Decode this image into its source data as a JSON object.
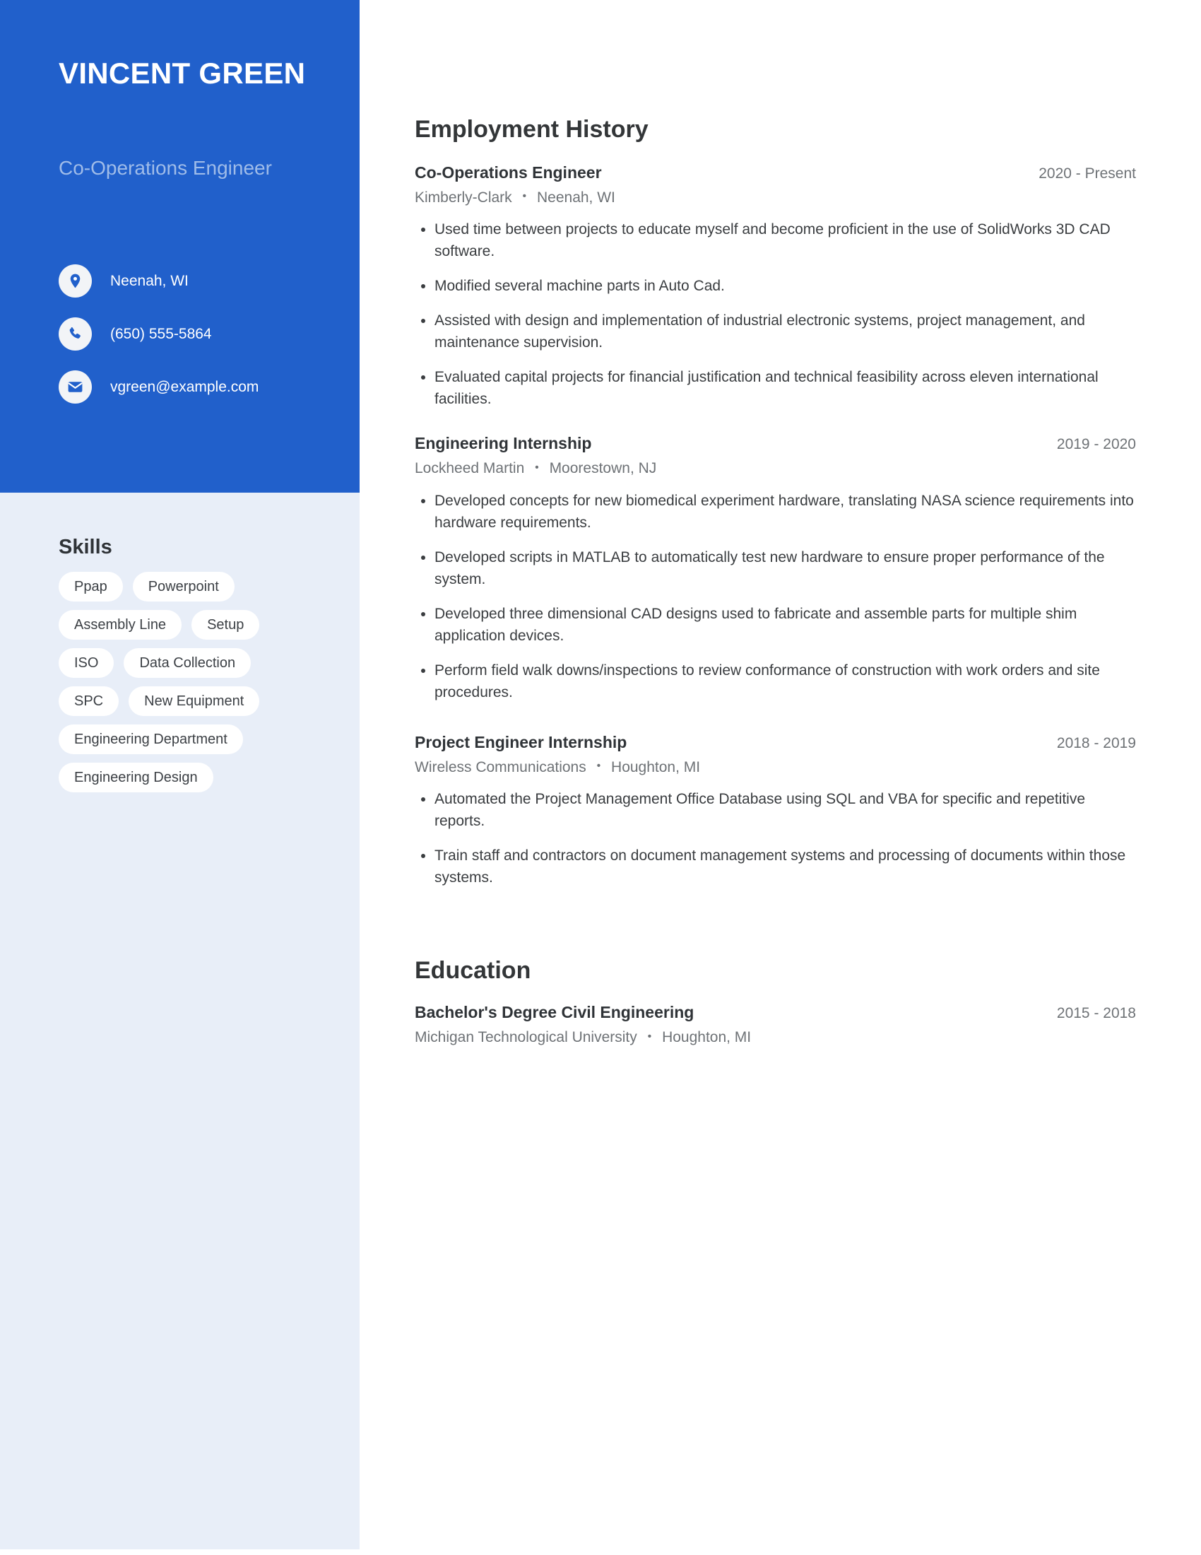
{
  "colors": {
    "accent": "#2160cb",
    "sidebar_bg": "#e8eef8",
    "subtitle": "#9fbce9",
    "heading": "#333638",
    "muted": "#6e7276"
  },
  "sidebar": {
    "name": "VINCENT GREEN",
    "job_title": "Co-Operations Engineer",
    "contacts": [
      {
        "icon": "location-pin-icon",
        "value": "Neenah, WI"
      },
      {
        "icon": "phone-icon",
        "value": "(650) 555-5864"
      },
      {
        "icon": "envelope-icon",
        "value": "vgreen@example.com"
      }
    ],
    "skills_heading": "Skills",
    "skills": [
      "Ppap",
      "Powerpoint",
      "Assembly Line",
      "Setup",
      "ISO",
      "Data Collection",
      "SPC",
      "New Equipment",
      "Engineering Department",
      "Engineering Design"
    ]
  },
  "main": {
    "employment": {
      "heading": "Employment History",
      "entries": [
        {
          "title": "Co-Operations Engineer",
          "date": "2020 - Present",
          "company": "Kimberly-Clark",
          "location": "Neenah, WI",
          "bullets": [
            "Used time between projects to educate myself and become proficient in the use of SolidWorks 3D CAD software.",
            "Modified several machine parts in Auto Cad.",
            "Assisted with design and implementation of industrial electronic systems, project management, and maintenance supervision.",
            "Evaluated capital projects for financial justification and technical feasibility across eleven international facilities."
          ]
        },
        {
          "title": "Engineering Internship",
          "date": "2019 - 2020",
          "company": "Lockheed Martin",
          "location": "Moorestown, NJ",
          "bullets": [
            "Developed concepts for new biomedical experiment hardware, translating NASA science requirements into hardware requirements.",
            "Developed scripts in MATLAB to automatically test new hardware to ensure proper performance of the system.",
            "Developed three dimensional CAD designs used to fabricate and assemble parts for multiple shim application devices.",
            "Perform field walk downs/inspections to review conformance of construction with work orders and site procedures."
          ]
        },
        {
          "title": "Project Engineer Internship",
          "date": "2018 - 2019",
          "company": "Wireless Communications",
          "location": "Houghton, MI",
          "bullets": [
            "Automated the Project Management Office Database using SQL and VBA for specific and repetitive reports.",
            "Train staff and contractors on document management systems and processing of documents within those systems."
          ]
        }
      ]
    },
    "education": {
      "heading": "Education",
      "entries": [
        {
          "title": "Bachelor's Degree Civil Engineering",
          "date": "2015 - 2018",
          "school": "Michigan Technological University",
          "location": "Houghton, MI"
        }
      ]
    },
    "separator": "•"
  }
}
